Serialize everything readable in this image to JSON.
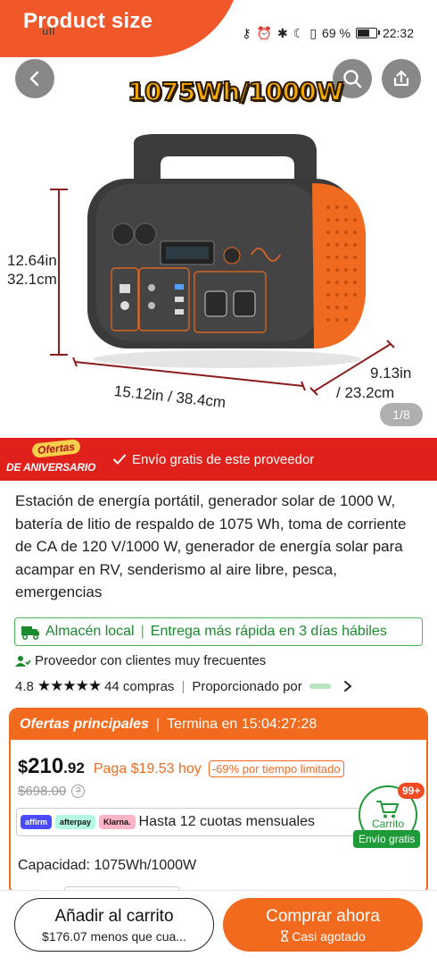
{
  "hero": {
    "badge_text": "Product size",
    "capacity_title": "1075Wh/1000W",
    "dimensions": {
      "height_in": "12.64in",
      "height_cm": "32.1cm",
      "width": "15.12in / 38.4cm",
      "depth_in": "9.13in",
      "depth_cm": "/ 23.2cm"
    },
    "pager": "1/8"
  },
  "status_bar": {
    "battery_percent": "69 %",
    "battery_level": 0.69,
    "time": "22:32",
    "signal": "ull"
  },
  "promo": {
    "badge_top": "Ofertas",
    "badge_bottom": "DE ANIVERSARIO",
    "text": "Envío gratis de este proveedor"
  },
  "product": {
    "title": "Estación de energía portátil, generador solar de 1000 W, batería de litio de respaldo de 1075 Wh, toma de corriente de CA de 120 V/1000 W, generador de energía solar para acampar en RV, senderismo al aire libre, pesca, emergencias",
    "local_warehouse": "Almacén local",
    "delivery": "Entrega más rápida en 3 días hábiles",
    "supplier": "Proveedor con clientes muy frecuentes",
    "rating": "4.8",
    "stars": "★★★★★",
    "purchases": "44 compras",
    "provided_by": "Proporcionado por"
  },
  "deals": {
    "title": "Ofertas principales",
    "ends_in": "Termina en 15:04:27:28",
    "price_currency": "$",
    "price_int": "210",
    "price_dec": ".92",
    "pay_text": "Paga $19.53 hoy",
    "discount": "-69% por tiempo limitado",
    "old_price": "$698.00",
    "installments_text": "Hasta 12 cuotas mensuales",
    "pay_logos": [
      "affirm",
      "afterpay",
      "Klarna."
    ],
    "capacity_label": "Capacidad: 1075Wh/1000W"
  },
  "cart": {
    "count": "99+",
    "label": "Carrito",
    "free_shipping": "Envío gratis"
  },
  "actions": {
    "add_to_cart": "Añadir al carrito",
    "add_sub": "$176.07 menos que cua...",
    "buy_now": "Comprar ahora",
    "buy_sub": "Casi agotado"
  },
  "colors": {
    "accent": "#f26a1d",
    "promo_red": "#e0201b",
    "green": "#1f9a38"
  }
}
